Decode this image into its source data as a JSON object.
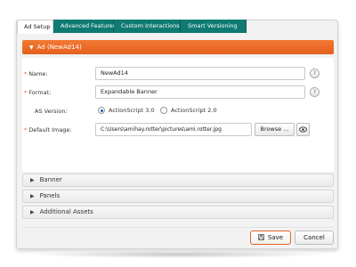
{
  "tabs": [
    {
      "label": "Ad Setup",
      "active": true
    },
    {
      "label": "Advanced Features",
      "active": false
    },
    {
      "label": "Custom Interactions",
      "active": false
    },
    {
      "label": "Smart Versioning",
      "active": false
    }
  ],
  "section": {
    "title": "Ad (NewAd14)",
    "icon": "triangle-down-icon"
  },
  "form": {
    "name": {
      "label": "Name:",
      "required": true,
      "value": "NewAd14",
      "help": "?"
    },
    "format": {
      "label": "Format:",
      "required": true,
      "value": "Expandable Banner",
      "help": "?"
    },
    "as_version": {
      "label": "AS Version:",
      "options": [
        {
          "label": "ActionScript 3.0",
          "selected": true
        },
        {
          "label": "ActionScript 2.0",
          "selected": false
        }
      ]
    },
    "default_image": {
      "label": "Default Image:",
      "required": true,
      "value": "C:\\Users\\amihay.rotter\\pictures\\ami.rotter.jpg",
      "browse_label": "Browse ...",
      "preview_icon": "eye-icon"
    }
  },
  "collapsibles": [
    {
      "label": "Banner",
      "icon": "triangle-right-icon"
    },
    {
      "label": "Panels",
      "icon": "triangle-right-icon"
    },
    {
      "label": "Additional Assets",
      "icon": "triangle-right-icon"
    }
  ],
  "footer": {
    "save_label": "Save",
    "save_icon": "floppy-disk-icon",
    "cancel_label": "Cancel"
  },
  "colors": {
    "accent_orange": "#e8672a",
    "tab_teal": "#0f7a72",
    "required_star": "#e0632a",
    "radio_selected": "#1a5fb4"
  }
}
